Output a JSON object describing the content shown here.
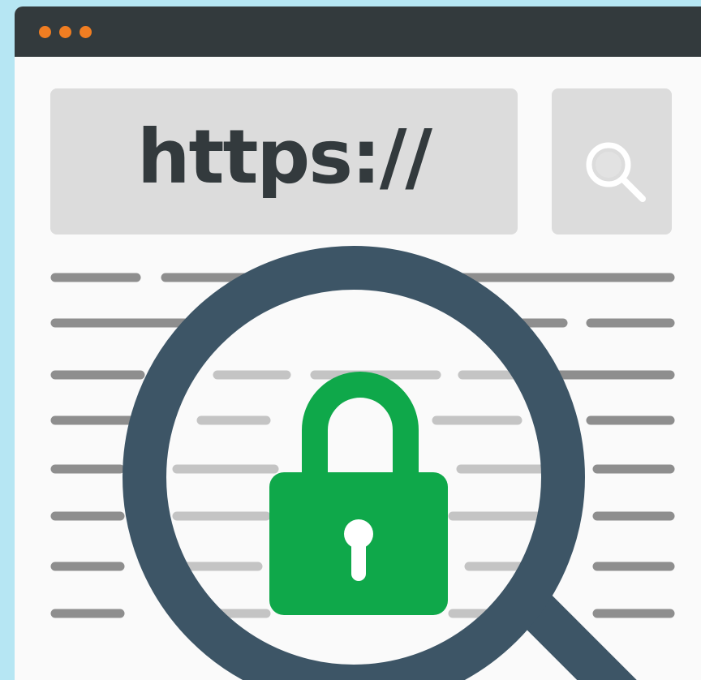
{
  "browser": {
    "title_bar": {
      "dots": [
        "orange",
        "orange",
        "orange"
      ],
      "dot_color": "#f07d22"
    },
    "address_bar": {
      "url_text": "https://"
    },
    "search_button": {
      "icon": "search-icon"
    }
  },
  "illustration": {
    "magnifier_icon": "magnifying-glass-icon",
    "lock_icon": "padlock-icon",
    "lock_color": "#0fa84a",
    "ring_color": "#3d5566"
  }
}
